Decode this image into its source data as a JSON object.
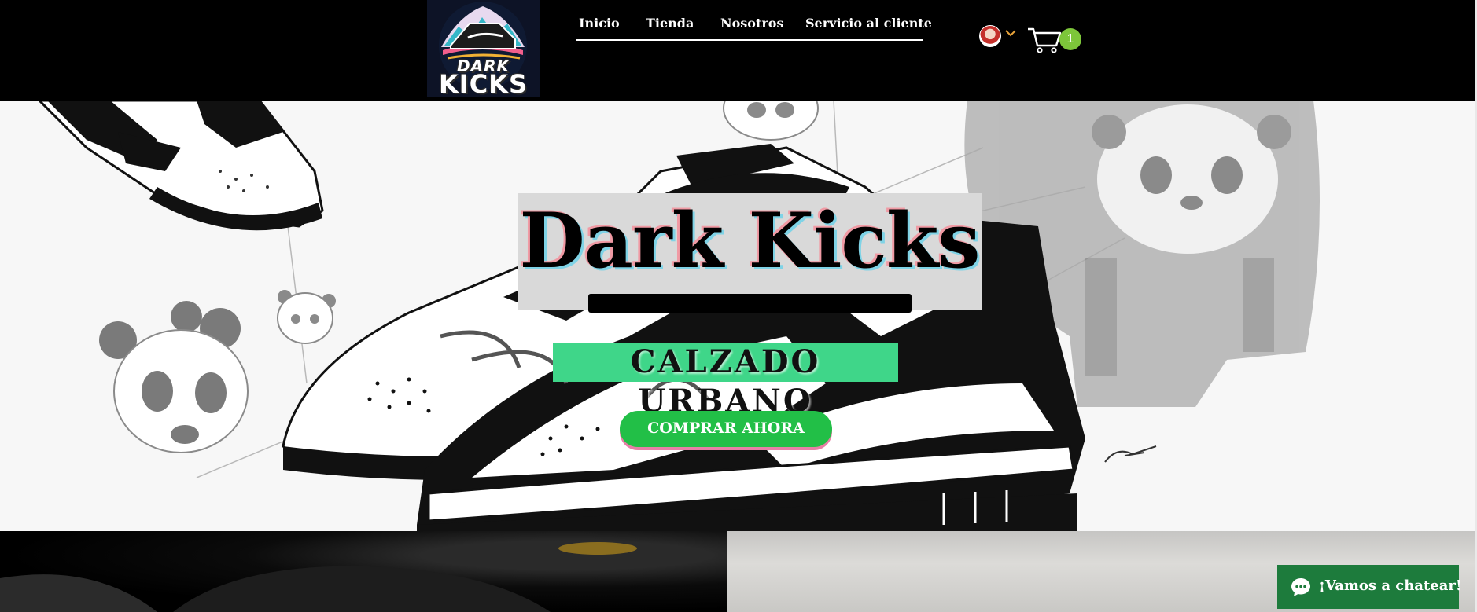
{
  "brand": {
    "logo_line1": "DARK",
    "logo_line2": "KICKS"
  },
  "nav": {
    "items": [
      {
        "label": "Inicio"
      },
      {
        "label": "Tienda"
      },
      {
        "label": "Nosotros"
      },
      {
        "label": "Servicio al cliente"
      }
    ]
  },
  "header": {
    "cart_count": "1",
    "icons": {
      "account": "user-avatar",
      "menu": "chevron-down-icon",
      "cart": "cart-icon"
    },
    "colors": {
      "background": "#000000",
      "badge": "#7dc63a",
      "chevron": "#e8a33a"
    }
  },
  "hero": {
    "title": "Dark Kicks",
    "subtitle": "CALZADO URBANO",
    "cta_label": "COMPRAR AHORA",
    "colors": {
      "cta": "#22bf47",
      "subtitle_bg": "#3fd689",
      "title_bg": "#d9d9d9"
    }
  },
  "chat": {
    "label": "¡Vamos a chatear!",
    "icon": "chat-bubble-icon",
    "color": "#1d7b3c"
  }
}
